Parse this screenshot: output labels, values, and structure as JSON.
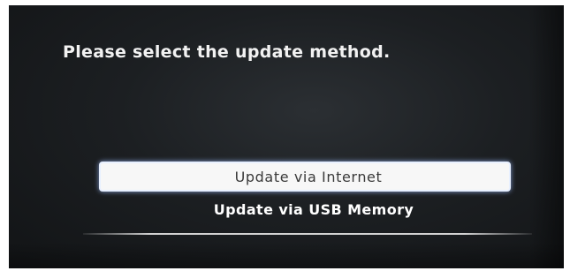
{
  "dialog": {
    "prompt": "Please select the update method.",
    "options": [
      {
        "label": "Update via Internet",
        "selected": true
      },
      {
        "label": "Update via USB Memory",
        "selected": false
      }
    ]
  },
  "colors": {
    "background": "#1c1f22",
    "highlight": "#f7f7f7",
    "text": "#ffffff"
  }
}
